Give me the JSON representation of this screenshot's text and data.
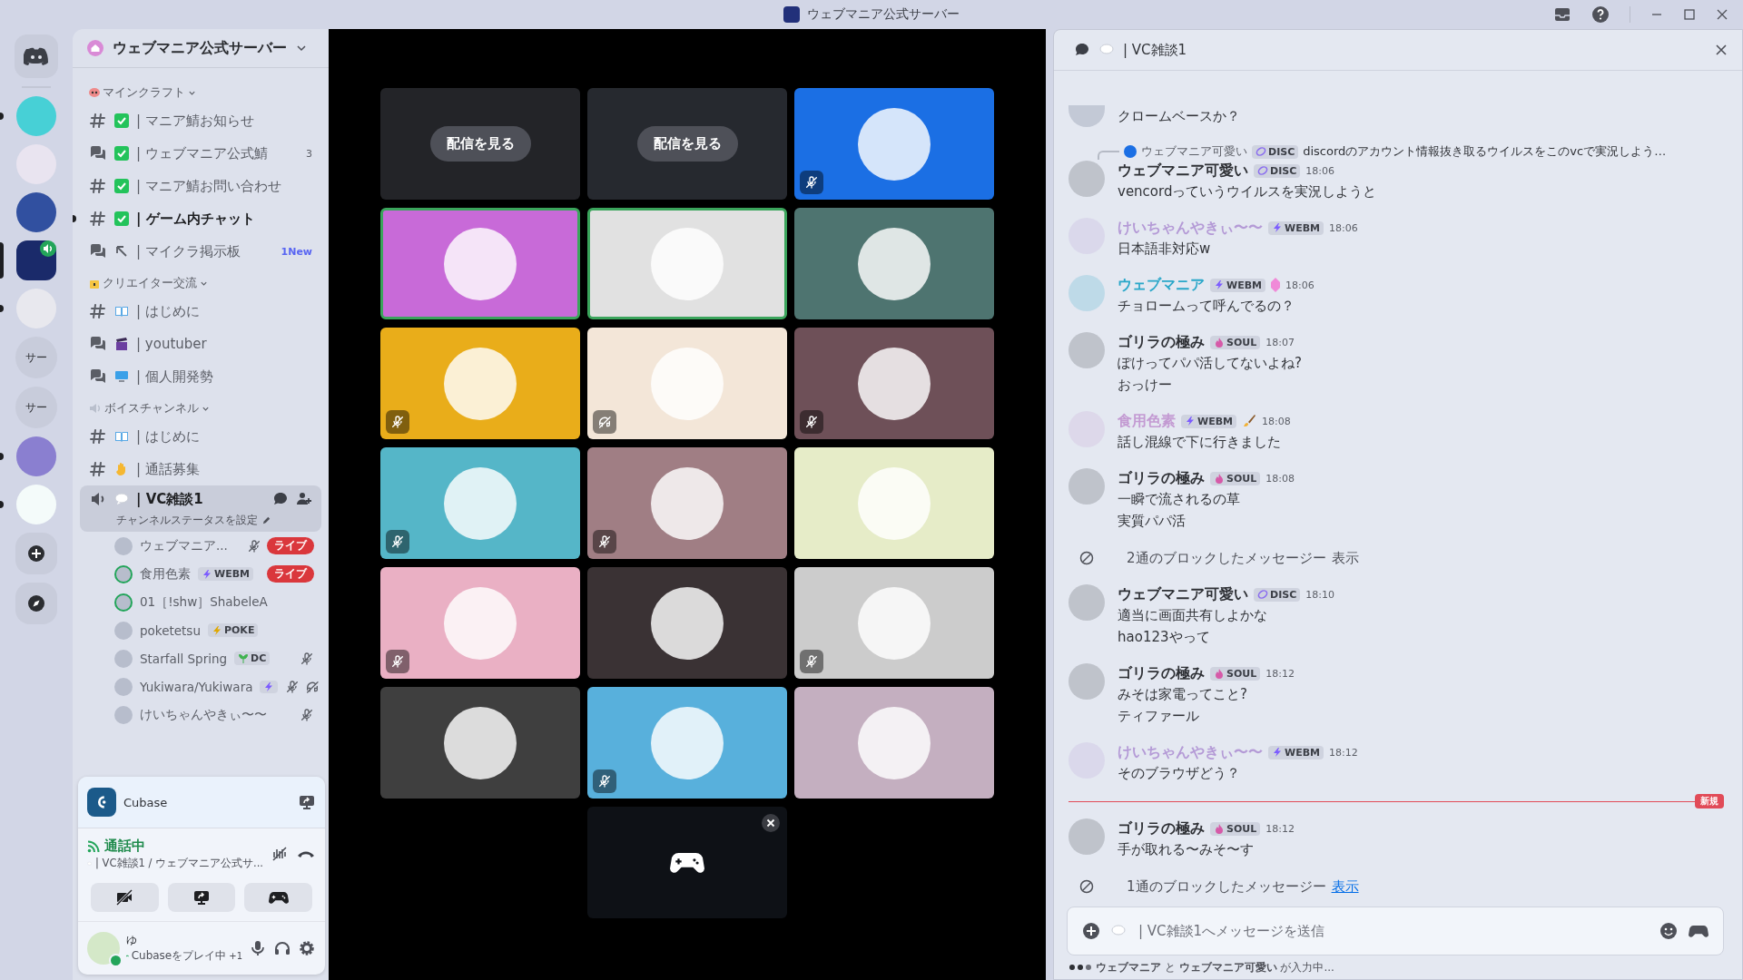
{
  "window": {
    "title": "ウェブマニア公式サーバー"
  },
  "servers": [
    {
      "kind": "avatar",
      "unread": true,
      "selected": false,
      "in_voice": false
    },
    {
      "kind": "avatar",
      "unread": false,
      "selected": false,
      "in_voice": false
    },
    {
      "kind": "avatar",
      "unread": false,
      "selected": false,
      "in_voice": false
    },
    {
      "kind": "avatar",
      "unread": false,
      "selected": true,
      "in_voice": true
    },
    {
      "kind": "avatar",
      "unread": true,
      "selected": false,
      "in_voice": false
    },
    {
      "kind": "text",
      "label": "サー",
      "unread": false,
      "selected": false,
      "in_voice": false
    },
    {
      "kind": "text",
      "label": "サー",
      "unread": false,
      "selected": false,
      "in_voice": false
    },
    {
      "kind": "avatar",
      "unread": true,
      "selected": false,
      "in_voice": false
    },
    {
      "kind": "avatar",
      "unread": true,
      "selected": false,
      "in_voice": false
    }
  ],
  "sidebar": {
    "server_name": "ウェブマニア公式サーバー",
    "categories": [
      {
        "name": "マインクラフト",
        "channels": [
          {
            "kind": "text",
            "name": "| マニア鯖お知らせ",
            "unread": false,
            "selected": false
          },
          {
            "kind": "forum",
            "name": "| ウェブマニア公式鯖",
            "unread": false,
            "selected": false,
            "badge": {
              "kind": "count",
              "text": "3"
            }
          },
          {
            "kind": "text",
            "name": "| マニア鯖お問い合わせ",
            "unread": false,
            "selected": false
          },
          {
            "kind": "text",
            "name": "| ゲーム内チャット",
            "unread": true,
            "selected": false
          },
          {
            "kind": "forum",
            "name": "| マイクラ掲示板",
            "unread": false,
            "selected": false,
            "badge": {
              "kind": "new",
              "text": "1New"
            }
          }
        ]
      },
      {
        "name": "クリエイター交流",
        "channels": [
          {
            "kind": "text",
            "name": "| はじめに",
            "unread": false,
            "selected": false
          },
          {
            "kind": "forum",
            "name": "| youtuber",
            "unread": false,
            "selected": false
          },
          {
            "kind": "forum",
            "name": "| 個人開発勢",
            "unread": false,
            "selected": false
          }
        ]
      },
      {
        "name": "ボイスチャンネル",
        "channels": [
          {
            "kind": "text",
            "name": "| はじめに",
            "unread": false,
            "selected": false
          },
          {
            "kind": "text",
            "name": "| 通話募集",
            "unread": false,
            "selected": false
          },
          {
            "kind": "voice",
            "name": "| VC雑談1",
            "unread": true,
            "selected": true,
            "status": "チャンネルステータスを設定",
            "members": [
              {
                "name": "ウェブマニア...",
                "muted": true,
                "deafened": false,
                "speaking": false,
                "live": "ライブ"
              },
              {
                "name": "食用色素",
                "tag": {
                  "kind": "bolt",
                  "text": "WEBM"
                },
                "muted": false,
                "deafened": false,
                "speaking": true,
                "live": "ライブ"
              },
              {
                "name": "01［!shw］ShabeleA",
                "muted": false,
                "deafened": false,
                "speaking": true
              },
              {
                "name": "poketetsu",
                "tag": {
                  "kind": "gold",
                  "text": "POKE"
                },
                "muted": false,
                "deafened": false,
                "speaking": false
              },
              {
                "name": "Starfall Spring",
                "tag": {
                  "kind": "sprout",
                  "text": "DC"
                },
                "muted": true,
                "deafened": false,
                "speaking": false
              },
              {
                "name": "Yukiwara/Yukiwara",
                "tag": {
                  "kind": "bolt"
                },
                "muted": true,
                "deafened": true,
                "speaking": false
              },
              {
                "name": "けいちゃんやきぃ〜〜",
                "muted": true,
                "deafened": false,
                "speaking": false
              }
            ]
          }
        ]
      }
    ]
  },
  "voice_panel": {
    "activity": "Cubase",
    "status": "通話中",
    "channel": "| VC雑談1 / ウェブマニア公式サ...",
    "user": {
      "name": "ゆ",
      "activity": "Cubaseをプレイ中",
      "extra": "+1"
    }
  },
  "tiles": [
    {
      "kind": "stream",
      "button": "配信を見る",
      "color": "#232428",
      "muted": false,
      "deafened": false,
      "speaking": false
    },
    {
      "kind": "stream",
      "button": "配信を見る",
      "color": "#26292f",
      "muted": false,
      "deafened": false,
      "speaking": false
    },
    {
      "kind": "avatar",
      "color": "#1b6fe4",
      "muted": true,
      "deafened": false,
      "speaking": false
    },
    {
      "kind": "avatar",
      "color": "#c86ad8",
      "muted": false,
      "deafened": false,
      "speaking": true
    },
    {
      "kind": "avatar",
      "color": "#e1e1e1",
      "muted": false,
      "deafened": false,
      "speaking": true
    },
    {
      "kind": "avatar",
      "color": "#4e7470",
      "muted": false,
      "deafened": false,
      "speaking": false
    },
    {
      "kind": "avatar",
      "color": "#e9ad1a",
      "muted": true,
      "deafened": false,
      "speaking": false
    },
    {
      "kind": "avatar",
      "color": "#f3e6d8",
      "muted": false,
      "deafened": true,
      "speaking": false
    },
    {
      "kind": "avatar",
      "color": "#6e5058",
      "muted": true,
      "deafened": false,
      "speaking": false
    },
    {
      "kind": "avatar",
      "color": "#55b6c8",
      "muted": true,
      "deafened": false,
      "speaking": false
    },
    {
      "kind": "avatar",
      "color": "#a07e84",
      "muted": true,
      "deafened": false,
      "speaking": false
    },
    {
      "kind": "avatar",
      "color": "#e6ecc8",
      "muted": false,
      "deafened": false,
      "speaking": false
    },
    {
      "kind": "avatar",
      "color": "#eab0c4",
      "muted": true,
      "deafened": false,
      "speaking": false
    },
    {
      "kind": "avatar",
      "color": "#3a3234",
      "muted": false,
      "deafened": false,
      "speaking": false
    },
    {
      "kind": "avatar",
      "color": "#cccccc",
      "muted": true,
      "deafened": false,
      "speaking": false
    },
    {
      "kind": "avatar",
      "color": "#3f3f3f",
      "muted": false,
      "deafened": false,
      "speaking": false
    },
    {
      "kind": "avatar",
      "color": "#58b0dc",
      "muted": true,
      "deafened": false,
      "speaking": false
    },
    {
      "kind": "avatar",
      "color": "#c4afc0",
      "muted": false,
      "deafened": false,
      "speaking": false
    },
    {
      "kind": "game",
      "color": "#0e1116",
      "muted": false,
      "deafened": false,
      "speaking": false
    }
  ],
  "chat": {
    "channel": "| VC雑談1",
    "messages": [
      {
        "kind": "continuation",
        "lines": [
          "クロームベースか？"
        ]
      },
      {
        "kind": "message",
        "reply": {
          "author": "ウェブマニア可愛い",
          "tag": {
            "kind": "disc",
            "text": "DISC"
          },
          "text": "discordのアカウント情報抜き取るウイルスをこのvcで実況しよう…"
        },
        "author": "ウェブマニア可愛い",
        "color": "#2e3035",
        "tag": {
          "kind": "disc",
          "text": "DISC"
        },
        "time": "18:06",
        "lines": [
          "vencordっていうウイルスを実況しようと"
        ]
      },
      {
        "kind": "message",
        "author": "けいちゃんやきぃ〜〜",
        "color": "#b49ad6",
        "tag": {
          "kind": "bolt",
          "text": "WEBM"
        },
        "time": "18:06",
        "lines": [
          "日本語非対応w"
        ]
      },
      {
        "kind": "message",
        "author": "ウェブマニア",
        "color": "#2aa7c9",
        "tag": {
          "kind": "bolt",
          "text": "WEBM"
        },
        "time": "18:06",
        "lines": [
          "チョロームって呼んでるの？"
        ]
      },
      {
        "kind": "message",
        "author": "ゴリラの極み",
        "color": "#2e3035",
        "tag": {
          "kind": "flame",
          "text": "SOUL"
        },
        "time": "18:07",
        "lines": [
          "ぽけってパパ活してないよね?",
          "おっけー"
        ]
      },
      {
        "kind": "message",
        "author": "食用色素",
        "color": "#c39ad2",
        "tag": {
          "kind": "bolt",
          "text": "WEBM"
        },
        "time": "18:08",
        "lines": [
          "話し混線で下に行きました"
        ]
      },
      {
        "kind": "message",
        "author": "ゴリラの極み",
        "color": "#2e3035",
        "tag": {
          "kind": "flame",
          "text": "SOUL"
        },
        "time": "18:08",
        "lines": [
          "一瞬で流されるの草",
          "実質パパ活"
        ]
      },
      {
        "kind": "blocked",
        "text": "2通のブロックしたメッセージー",
        "link": "表示",
        "hovered": false
      },
      {
        "kind": "message",
        "author": "ウェブマニア可愛い",
        "color": "#2e3035",
        "tag": {
          "kind": "disc",
          "text": "DISC"
        },
        "time": "18:10",
        "lines": [
          "適当に画面共有しよかな",
          "hao123やって"
        ]
      },
      {
        "kind": "message",
        "author": "ゴリラの極み",
        "color": "#2e3035",
        "tag": {
          "kind": "flame",
          "text": "SOUL"
        },
        "time": "18:12",
        "lines": [
          "みそは家電ってこと?",
          "ティファール"
        ]
      },
      {
        "kind": "message",
        "author": "けいちゃんやきぃ〜〜",
        "color": "#b49ad6",
        "tag": {
          "kind": "bolt",
          "text": "WEBM"
        },
        "time": "18:12",
        "lines": [
          "そのブラウザどう？"
        ]
      },
      {
        "kind": "divider",
        "label": "新規"
      },
      {
        "kind": "message",
        "author": "ゴリラの極み",
        "color": "#2e3035",
        "tag": {
          "kind": "flame",
          "text": "SOUL"
        },
        "time": "18:12",
        "lines": [
          "手が取れる〜みそ〜す"
        ]
      },
      {
        "kind": "blocked",
        "text": "1通のブロックしたメッセージー",
        "link": "表示",
        "hovered": true
      }
    ],
    "input": {
      "placeholder": "| VC雑談1へメッセージを送信"
    },
    "typing": "**ウェブマニア** と **ウェブマニア可愛い** が入力中..."
  }
}
